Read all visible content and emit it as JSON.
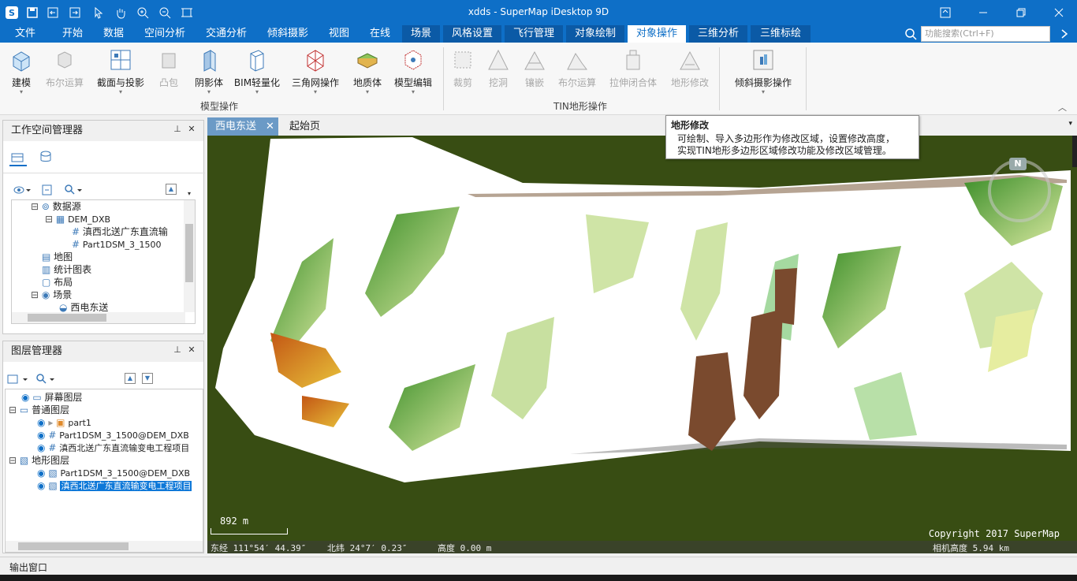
{
  "window": {
    "title": "xdds - SuperMap iDesktop 9D"
  },
  "menu": {
    "tabs": [
      "文件",
      "开始",
      "数据",
      "空间分析",
      "交通分析",
      "倾斜摄影",
      "视图",
      "在线",
      "场景",
      "风格设置",
      "飞行管理",
      "对象绘制",
      "对象操作",
      "三维分析",
      "三维标绘"
    ],
    "search_placeholder": "功能搜索(Ctrl+F)"
  },
  "ribbon": {
    "buttons": [
      "建模",
      "布尔运算",
      "截面与投影",
      "凸包",
      "阴影体",
      "BIM轻量化",
      "三角网操作",
      "地质体",
      "模型编辑",
      "裁剪",
      "挖洞",
      "镶嵌",
      "布尔运算",
      "拉伸闭合体",
      "地形修改",
      "倾斜摄影操作"
    ],
    "groups": [
      "模型操作",
      "TIN地形操作"
    ]
  },
  "tooltip": {
    "title": "地形修改",
    "lines": [
      "可绘制、导入多边形作为修改区域，设置修改高度，",
      "实现TIN地形多边形区域修改功能及修改区域管理。"
    ]
  },
  "workspace": {
    "title": "工作空间管理器",
    "items": [
      "数据源",
      "DEM_DXB",
      "滇西北送广东直流输",
      "Part1DSM_3_1500",
      "地图",
      "统计图表",
      "布局",
      "场景",
      "西电东送"
    ]
  },
  "layers": {
    "title": "图层管理器",
    "items": [
      "屏幕图层",
      "普通图层",
      "part1",
      "Part1DSM_3_1500@DEM_DXB",
      "滇西北送广东直流输变电工程项目",
      "地形图层",
      "Part1DSM_3_1500@DEM_DXB",
      "滇西北送广东直流输变电工程项目"
    ]
  },
  "doc_tabs": [
    "西电东送",
    "起始页"
  ],
  "map": {
    "scale": "892 m",
    "copyright": "Copyright 2017 SuperMap",
    "lon": "东经 111°54′ 44.39″",
    "lat": "北纬 24°7′ 0.23″",
    "elev": "高度 0.00 m",
    "cam": "相机高度 5.94 km",
    "compass": "N"
  },
  "status": {
    "output": "输出窗口"
  }
}
